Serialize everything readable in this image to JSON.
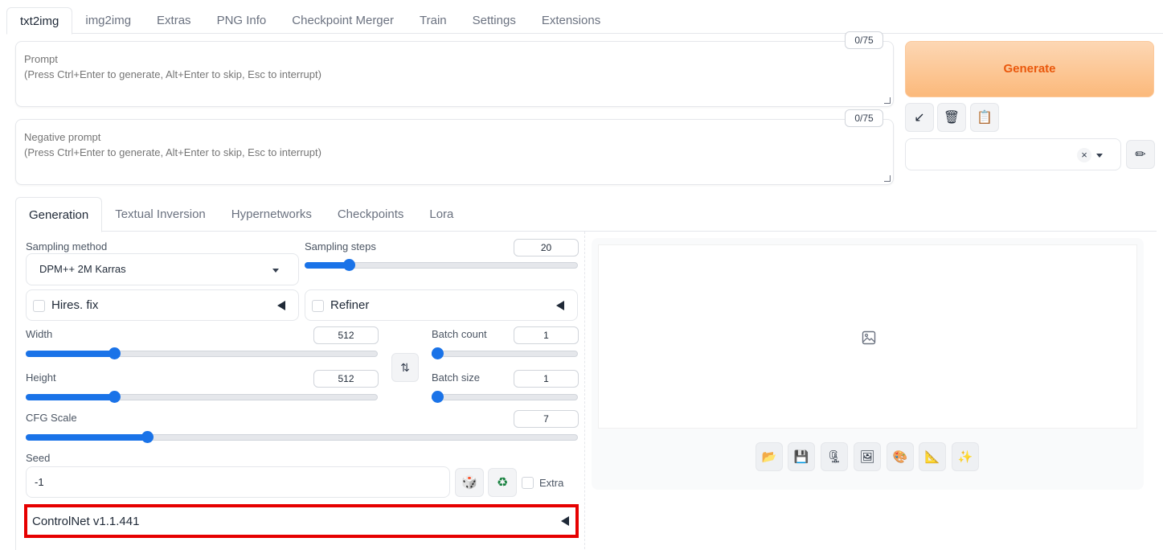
{
  "top_tabs": [
    "txt2img",
    "img2img",
    "Extras",
    "PNG Info",
    "Checkpoint Merger",
    "Train",
    "Settings",
    "Extensions"
  ],
  "prompt": {
    "placeholder": "Prompt\n(Press Ctrl+Enter to generate, Alt+Enter to skip, Esc to interrupt)",
    "token_count": "0/75"
  },
  "negative_prompt": {
    "placeholder": "Negative prompt\n(Press Ctrl+Enter to generate, Alt+Enter to skip, Esc to interrupt)",
    "token_count": "0/75"
  },
  "generate": {
    "label": "Generate"
  },
  "tools": {
    "apply_icon": "↙",
    "trash_icon": "🗑",
    "clipboard_icon": "📋",
    "clear_icon": "×",
    "edit_icon": "✏"
  },
  "sub_tabs": [
    "Generation",
    "Textual Inversion",
    "Hypernetworks",
    "Checkpoints",
    "Lora"
  ],
  "generation": {
    "sampling_method_label": "Sampling method",
    "sampling_method_value": "DPM++ 2M Karras",
    "sampling_steps_label": "Sampling steps",
    "sampling_steps_value": "20",
    "sampling_steps_fraction": 0.14,
    "hires_fix_label": "Hires. fix",
    "refiner_label": "Refiner",
    "width_label": "Width",
    "width_value": "512",
    "width_fraction": 0.235,
    "height_label": "Height",
    "height_value": "512",
    "height_fraction": 0.235,
    "batch_count_label": "Batch count",
    "batch_count_value": "1",
    "batch_count_fraction": 0.0,
    "batch_size_label": "Batch size",
    "batch_size_value": "1",
    "batch_size_fraction": 0.0,
    "cfg_label": "CFG Scale",
    "cfg_value": "7",
    "cfg_fraction": 0.21,
    "swap_icon": "⇅",
    "seed_label": "Seed",
    "seed_value": "-1",
    "dice_icon": "🎲",
    "recycle_icon": "♻",
    "extra_label": "Extra",
    "controlnet_label": "ControlNet v1.1.441"
  },
  "output": {
    "image_placeholder_icon": "🖼",
    "buttons": [
      "📂",
      "💾",
      "🗜",
      "🖼",
      "🎨",
      "📐",
      "✨"
    ]
  }
}
